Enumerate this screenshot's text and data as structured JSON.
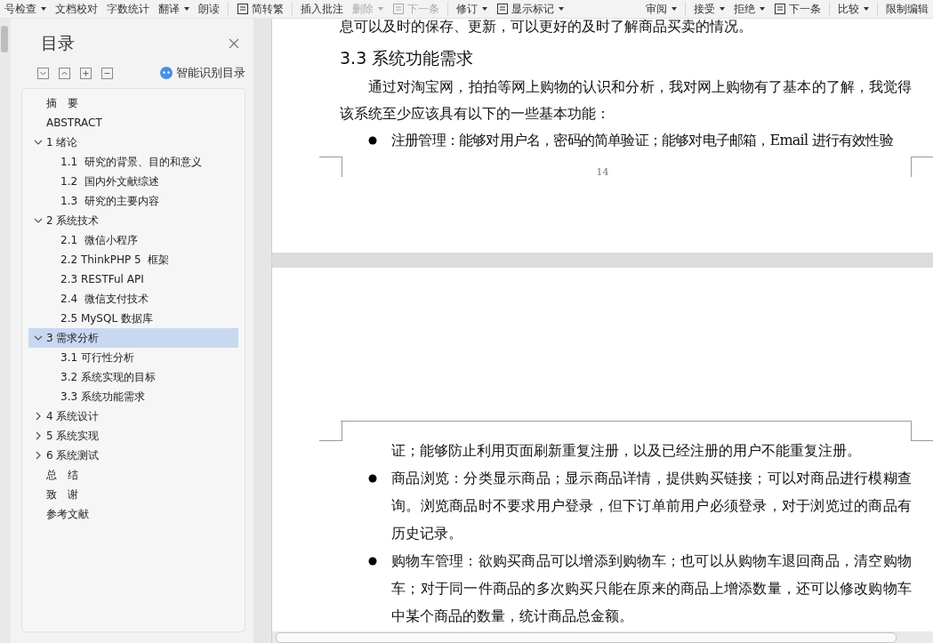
{
  "ribbon": [
    {
      "kind": "button",
      "label": "号检查",
      "dropdown": true,
      "disabled": false
    },
    {
      "kind": "button",
      "label": "文档校对",
      "dropdown": false,
      "disabled": false
    },
    {
      "kind": "button",
      "label": "字数统计",
      "dropdown": false,
      "disabled": false
    },
    {
      "kind": "button",
      "label": "翻译",
      "dropdown": true,
      "disabled": false
    },
    {
      "kind": "button",
      "label": "朗读",
      "dropdown": false,
      "disabled": false
    },
    {
      "kind": "separator"
    },
    {
      "kind": "icon-button",
      "label": "简转繁",
      "dropdown": false,
      "disabled": false
    },
    {
      "kind": "separator"
    },
    {
      "kind": "button",
      "label": "插入批注",
      "dropdown": false,
      "disabled": false
    },
    {
      "kind": "button",
      "label": "删除",
      "dropdown": true,
      "disabled": true
    },
    {
      "kind": "icon-button",
      "label": "下一条",
      "dropdown": false,
      "disabled": true
    },
    {
      "kind": "separator"
    },
    {
      "kind": "button",
      "label": "修订",
      "dropdown": true,
      "disabled": false
    },
    {
      "kind": "icon-button",
      "label": "显示标记",
      "dropdown": true,
      "disabled": false
    },
    {
      "kind": "spacer"
    },
    {
      "kind": "button",
      "label": "审阅",
      "dropdown": true,
      "disabled": false
    },
    {
      "kind": "separator"
    },
    {
      "kind": "button",
      "label": "接受",
      "dropdown": true,
      "disabled": false
    },
    {
      "kind": "button",
      "label": "拒绝",
      "dropdown": true,
      "disabled": false
    },
    {
      "kind": "icon-button",
      "label": "下一条",
      "dropdown": false,
      "disabled": false
    },
    {
      "kind": "separator"
    },
    {
      "kind": "button",
      "label": "比较",
      "dropdown": true,
      "disabled": false
    },
    {
      "kind": "separator"
    },
    {
      "kind": "button",
      "label": "限制编辑",
      "dropdown": false,
      "disabled": false
    }
  ],
  "toc": {
    "title": "目录",
    "smart_button": "智能识别目录",
    "items": [
      {
        "kind": "plain",
        "label": "摘　要",
        "selected": false
      },
      {
        "kind": "plain",
        "label": "ABSTRACT",
        "selected": false
      },
      {
        "kind": "chapter",
        "label": "1 绪论",
        "expanded": true,
        "selected": false,
        "children": [
          {
            "label": "1.1  研究的背景、目的和意义",
            "selected": false
          },
          {
            "label": "1.2  国内外文献综述",
            "selected": false
          },
          {
            "label": "1.3  研究的主要内容",
            "selected": false
          }
        ]
      },
      {
        "kind": "chapter",
        "label": "2 系统技术",
        "expanded": true,
        "selected": false,
        "children": [
          {
            "label": "2.1  微信小程序",
            "selected": false
          },
          {
            "label": "2.2 ThinkPHP 5  框架",
            "selected": false
          },
          {
            "label": "2.3 RESTFul API",
            "selected": false
          },
          {
            "label": "2.4  微信支付技术",
            "selected": false
          },
          {
            "label": "2.5 MySQL 数据库",
            "selected": false
          }
        ]
      },
      {
        "kind": "chapter",
        "label": "3 需求分析",
        "expanded": true,
        "selected": true,
        "children": [
          {
            "label": "3.1 可行性分析",
            "selected": false
          },
          {
            "label": "3.2 系统实现的目标",
            "selected": false
          },
          {
            "label": "3.3 系统功能需求",
            "selected": false
          }
        ]
      },
      {
        "kind": "chapter",
        "label": "4 系统设计",
        "expanded": false,
        "selected": false
      },
      {
        "kind": "chapter",
        "label": "5 系统实现",
        "expanded": false,
        "selected": false
      },
      {
        "kind": "chapter",
        "label": "6 系统测试",
        "expanded": false,
        "selected": false
      },
      {
        "kind": "plain",
        "label": "总　结",
        "selected": false
      },
      {
        "kind": "plain",
        "label": "致　谢",
        "selected": false
      },
      {
        "kind": "plain",
        "label": "参考文献",
        "selected": false
      }
    ]
  },
  "pages": [
    {
      "blocks": [
        {
          "kind": "continuation",
          "text": "息可以及时的保存、更新，可以更好的及时了解商品买卖的情况。"
        },
        {
          "kind": "heading",
          "text": "3.3 系统功能需求"
        },
        {
          "kind": "paragraph",
          "text": "通过对淘宝网，拍拍等网上购物的认识和分析，我对网上购物有了基本的了解，我觉得该系统至少应该具有以下的一些基本功能："
        },
        {
          "kind": "bullet",
          "text": "注册管理：能够对用户名，密码的简单验证；能够对电子邮箱，Email 进行有效性验"
        }
      ],
      "page_number": "14"
    },
    {
      "blocks": [
        {
          "kind": "continuation",
          "text": "证；能够防止利用页面刷新重复注册，以及已经注册的用户不能重复注册。"
        },
        {
          "kind": "bullet",
          "text": "商品浏览：分类显示商品；显示商品详情，提供购买链接；可以对商品进行模糊查询。浏览商品时不要求用户登录，但下订单前用户必须登录，对于浏览过的商品有历史记录。"
        },
        {
          "kind": "bullet",
          "text": "购物车管理：欲购买商品可以增添到购物车；也可以从购物车退回商品，清空购物车；对于同一件商品的多次购买只能在原来的商品上增添数量，还可以修改购物车中某个商品的数量，统计商品总金额。"
        }
      ]
    }
  ]
}
